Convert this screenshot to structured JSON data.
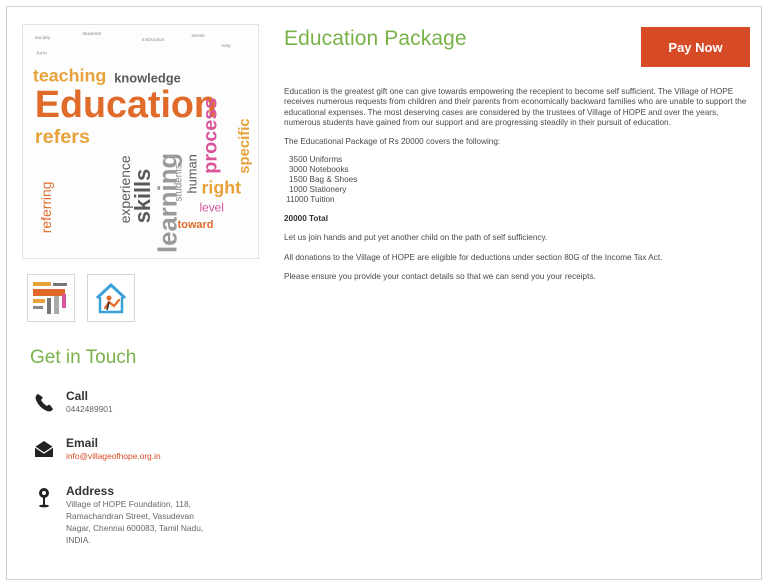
{
  "product": {
    "title": "Education Package",
    "pay_button": "Pay Now",
    "description": [
      "Education is the greatest gift one can give towards empowering the recepient to become self sufficient. The Village of HOPE receives numerous requests from children and their parents from economically backward families who are unable to support the educational expenses. The most deserving cases are considered by the trustees of Village of HOPE and over the years, numerous students have gained from our support and are progressing steadily in their pursuit of education.",
      "The Educational Package of Rs 20000 covers the following:"
    ],
    "items": [
      "3500 Uniforms",
      "3000 Notebooks",
      "1500 Bag & Shoes",
      "1000 Stationery",
      "11000 Tuition"
    ],
    "total": "20000 Total",
    "footer_paragraphs": [
      "Let us join hands and put yet another child on the path of self sufficiency.",
      "All donations to the Village of HOPE are eligible for deductions under section 80G of the Income Tax Act.",
      "Please ensure you provide your contact details so that we can send you your receipts."
    ]
  },
  "image": {
    "main_word": "Education",
    "words": [
      "teaching",
      "knowledge",
      "refers",
      "process",
      "right",
      "skills",
      "learning",
      "experience",
      "referring",
      "specific",
      "toward",
      "level",
      "human",
      "students",
      "instruction",
      "society",
      "sense",
      "may",
      "form",
      "values"
    ]
  },
  "contact": {
    "heading": "Get in Touch",
    "call_label": "Call",
    "call_value": "0442489901",
    "email_label": "Email",
    "email_value": "info@villageofhope.org.in",
    "address_label": "Address",
    "address_lines": [
      "Village of HOPE Foundation, 118,",
      "Ramachandran Street, Vasudevan",
      "Nagar, Chennai 600083, Tamil Nadu,",
      "INDIA."
    ]
  },
  "colors": {
    "accent_green": "#7ab24a",
    "accent_orange": "#d74a26"
  }
}
